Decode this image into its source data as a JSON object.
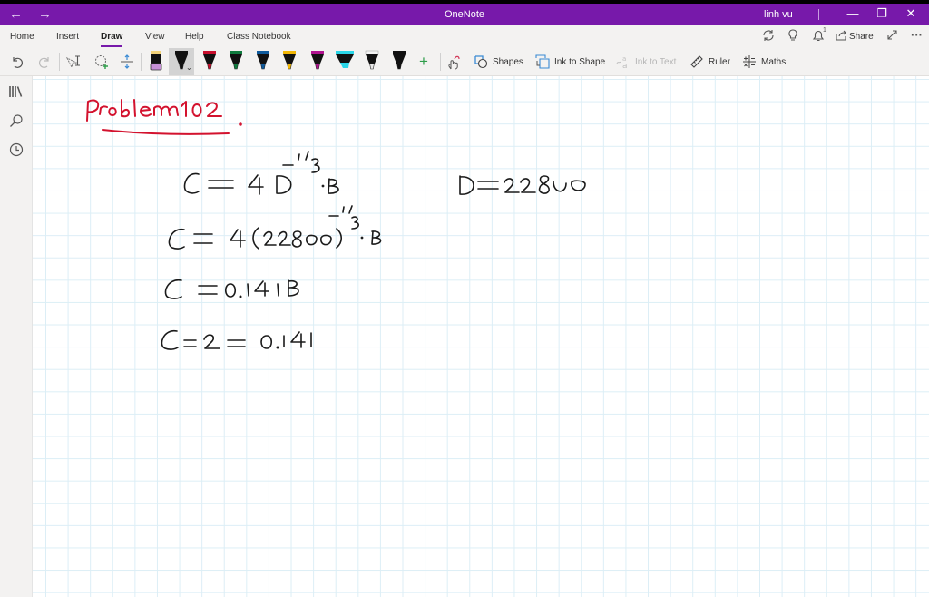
{
  "titlebar": {
    "back_icon": "←",
    "forward_icon": "→",
    "app_title": "OneNote",
    "user_name": "linh vu",
    "minimize": "—",
    "restore": "❐",
    "close": "✕"
  },
  "ribbon": {
    "tabs": [
      {
        "label": "Home"
      },
      {
        "label": "Insert"
      },
      {
        "label": "Draw",
        "active": true
      },
      {
        "label": "View"
      },
      {
        "label": "Help"
      },
      {
        "label": "Class Notebook"
      }
    ],
    "top_right": {
      "sync_icon": "⟳",
      "lightbulb_icon": "💡",
      "notifications_count": "1",
      "share_label": "Share",
      "expand_icon": "⤢",
      "more_icon": "···"
    },
    "tools": {
      "shapes_label": "Shapes",
      "ink_to_shape_label": "Ink to Shape",
      "ink_to_text_label": "Ink to Text",
      "ruler_label": "Ruler",
      "maths_label": "Maths"
    },
    "pens": [
      {
        "name": "eraser",
        "color": "#c690d6"
      },
      {
        "name": "black-pen-selected",
        "color": "#111111"
      },
      {
        "name": "red-pen",
        "color": "#c8102e"
      },
      {
        "name": "green-pen",
        "color": "#0f7b3e"
      },
      {
        "name": "blue-pen",
        "color": "#0e5a9c"
      },
      {
        "name": "yellow-pen",
        "color": "#f2b705"
      },
      {
        "name": "magenta-galaxy-pen",
        "color": "#b0128f"
      },
      {
        "name": "cyan-highlighter",
        "color": "#2ad6e8"
      },
      {
        "name": "white-pen",
        "color": "#ffffff"
      },
      {
        "name": "black-pen",
        "color": "#111111"
      }
    ],
    "add_pen_icon": "+"
  },
  "colors": {
    "accent": "#7719aa",
    "ink_black": "#1a1a1a",
    "ink_red": "#d3122e",
    "grid": "#dceef6"
  },
  "page": {
    "title_ink": "Problem 102",
    "lines": [
      "C = 4 D^(-1/3) · B",
      "D = 22800",
      "C = 4(22800)^(-1/3) · B",
      "C = 0.141 B",
      "C = 2 = 0.141"
    ]
  }
}
